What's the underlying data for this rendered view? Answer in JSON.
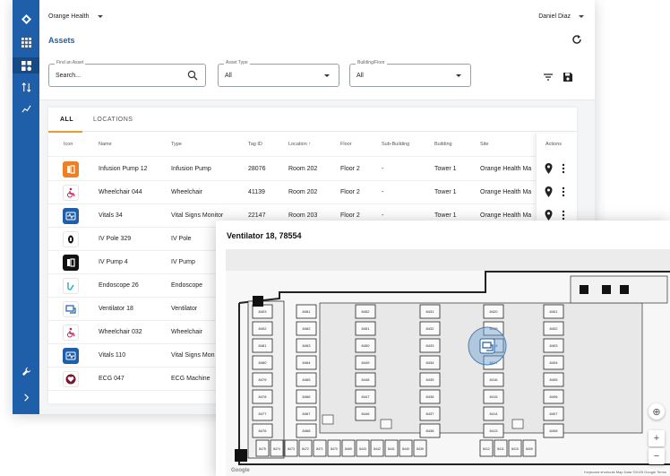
{
  "header": {
    "org_name": "Orange Health",
    "user_name": "Daniel Diaz",
    "page_title": "Assets"
  },
  "filters": {
    "find": {
      "label": "Find an Asset",
      "placeholder": "Search..."
    },
    "asset_type": {
      "label": "Asset Type",
      "value": "All"
    },
    "building_floor": {
      "label": "Building/Floor",
      "value": "All"
    }
  },
  "tabs": [
    {
      "label": "ALL",
      "active": true
    },
    {
      "label": "LOCATIONS",
      "active": false
    }
  ],
  "table": {
    "columns": [
      "Icon",
      "Name",
      "Type",
      "Tag ID",
      "Location ↑",
      "Floor",
      "Sub-Building",
      "Building",
      "Site"
    ],
    "actions_header": "Actions",
    "rows": [
      {
        "icon": "infusion-pump-icon",
        "color": "#ef7f22",
        "name": "Infusion Pump 12",
        "type": "Infusion Pump",
        "tag": "28076",
        "location": "Room 202",
        "floor": "Floor 2",
        "sub": "-",
        "building": "Tower 1",
        "site": "Orange Health Ma"
      },
      {
        "icon": "wheelchair-icon",
        "color": "#ffffff",
        "name": "Wheelchair 044",
        "type": "Wheelchair",
        "tag": "41139",
        "location": "Room 202",
        "floor": "Floor 2",
        "sub": "-",
        "building": "Tower 1",
        "site": "Orange Health Ma"
      },
      {
        "icon": "vitals-monitor-icon",
        "color": "#1f5fa9",
        "name": "Vitals 34",
        "type": "Vital Signs Monitor",
        "tag": "22147",
        "location": "Room 203",
        "floor": "Floor 2",
        "sub": "-",
        "building": "Tower 1",
        "site": "Orange Health Ma"
      },
      {
        "icon": "iv-pole-icon",
        "color": "#ffffff",
        "name": "IV Pole 329",
        "type": "IV Pole"
      },
      {
        "icon": "iv-pump-icon",
        "color": "#111111",
        "name": "IV Pump 4",
        "type": "IV Pump"
      },
      {
        "icon": "endoscope-icon",
        "color": "#ffffff",
        "name": "Endoscope 26",
        "type": "Endoscope"
      },
      {
        "icon": "ventilator-icon",
        "color": "#ffffff",
        "name": "Ventilator 18",
        "type": "Ventilator"
      },
      {
        "icon": "wheelchair-icon",
        "color": "#ffffff",
        "name": "Wheelchair 032",
        "type": "Wheelchair"
      },
      {
        "icon": "vitals-monitor-icon",
        "color": "#1f5fa9",
        "name": "Vitals 110",
        "type": "Vital Signs Mon"
      },
      {
        "icon": "heart-icon",
        "color": "#ffffff",
        "name": "ECG 047",
        "type": "ECG Machine"
      }
    ]
  },
  "map_popup": {
    "title": "Ventilator 18, 78554",
    "attribution": "Keyboard shortcuts  Map Data ©2025 Google  Terms",
    "logo": "Google",
    "rooms": {
      "col1": [
        "8403",
        "8402",
        "8481",
        "8480",
        "8479",
        "8478",
        "8477",
        "8476"
      ],
      "col2": [
        "8461",
        "8462",
        "8463",
        "8464",
        "8465",
        "8466",
        "8467",
        "8468"
      ],
      "col3": [
        "8452",
        "8451",
        "8450",
        "8449",
        "8448",
        "8447",
        "8446"
      ],
      "col4": [
        "8431",
        "8432",
        "8433",
        "8434",
        "8435",
        "8436",
        "8437",
        "8438"
      ],
      "col5": [
        "8420",
        "8419",
        "8418",
        "8417",
        "8416",
        "8415",
        "8414",
        "8413"
      ],
      "col6": [
        "8401",
        "8402",
        "8403",
        "8404",
        "8405",
        "8406",
        "8407",
        "8408"
      ],
      "bottom": [
        "8475",
        "8474",
        "8473",
        "8472",
        "8471",
        "8470",
        "8469",
        "8443",
        "8442",
        "8441",
        "8440",
        "8439",
        "8412",
        "8411",
        "8410",
        "8409"
      ],
      "extra": [
        "8469",
        "8444",
        "8445"
      ]
    }
  }
}
